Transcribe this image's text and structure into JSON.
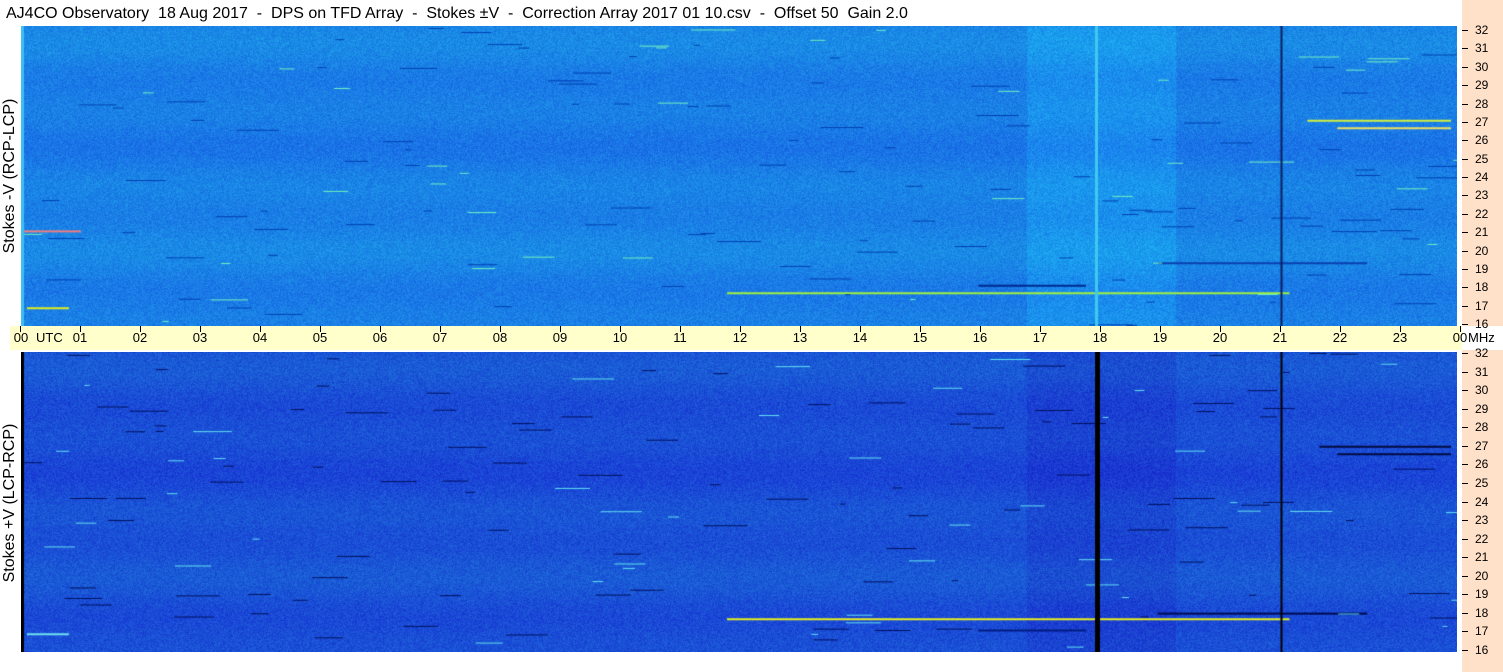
{
  "title": "AJ4CO Observatory  18 Aug 2017  -  DPS on TFD Array  -  Stokes ±V  -  Correction Array 2017 01 10.csv  -  Offset 50  Gain 2.0",
  "chart_data": [
    {
      "type": "heatmap",
      "name": "Stokes -V (RCP-LCP)",
      "ylabel": "Stokes -V (RCP-LCP)",
      "x_unit": "UTC",
      "y_unit": "MHz",
      "xlim": [
        0,
        24
      ],
      "ylim": [
        16,
        32
      ],
      "x_ticks": [
        "00",
        "01",
        "02",
        "03",
        "04",
        "05",
        "06",
        "07",
        "08",
        "09",
        "10",
        "11",
        "12",
        "13",
        "14",
        "15",
        "16",
        "17",
        "18",
        "19",
        "20",
        "21",
        "22",
        "23",
        "00"
      ],
      "y_ticks": [
        16,
        17,
        18,
        19,
        20,
        21,
        22,
        23,
        24,
        25,
        26,
        27,
        28,
        29,
        30,
        31,
        32
      ],
      "base_color": "#1a7fe6",
      "grid": false
    },
    {
      "type": "heatmap",
      "name": "Stokes +V (LCP-RCP)",
      "ylabel": "Stokes +V (LCP-RCP)",
      "x_unit": "UTC",
      "y_unit": "MHz",
      "xlim": [
        0,
        24
      ],
      "ylim": [
        16,
        32
      ],
      "x_ticks": [
        "00",
        "01",
        "02",
        "03",
        "04",
        "05",
        "06",
        "07",
        "08",
        "09",
        "10",
        "11",
        "12",
        "13",
        "14",
        "15",
        "16",
        "17",
        "18",
        "19",
        "20",
        "21",
        "22",
        "23",
        "00"
      ],
      "y_ticks": [
        16,
        17,
        18,
        19,
        20,
        21,
        22,
        23,
        24,
        25,
        26,
        27,
        28,
        29,
        30,
        31,
        32
      ],
      "base_color": "#1a4fd6",
      "grid": false
    }
  ],
  "axis": {
    "utc_label": "UTC",
    "mhz_label": "MHz"
  }
}
